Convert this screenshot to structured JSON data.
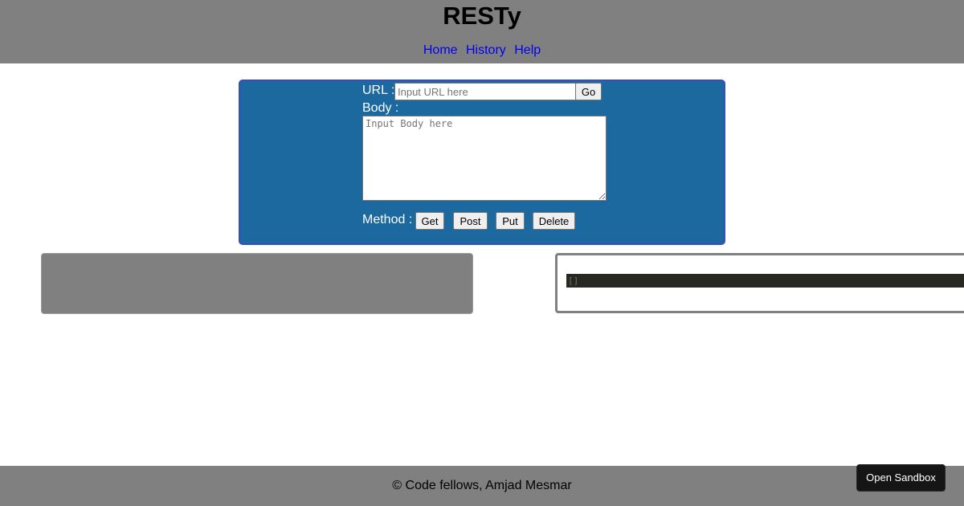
{
  "header": {
    "title": "RESTy",
    "nav": [
      {
        "label": "Home"
      },
      {
        "label": "History"
      },
      {
        "label": "Help"
      }
    ]
  },
  "form": {
    "url_label": "URL :",
    "url_placeholder": "Input URL here",
    "go_label": "Go",
    "body_label": "Body :",
    "body_placeholder": "Input Body here",
    "method_label": "Method :",
    "methods": [
      {
        "label": "Get"
      },
      {
        "label": "Post"
      },
      {
        "label": "Put"
      },
      {
        "label": "Delete"
      }
    ]
  },
  "results": {
    "json_text": "[]"
  },
  "footer": {
    "text": "© Code fellows, Amjad Mesmar"
  },
  "sandbox": {
    "label": "Open Sandbox"
  },
  "colors": {
    "header_bg": "#808080",
    "form_bg": "#1b699e",
    "link": "#0000ee",
    "json_bg": "#272822"
  }
}
